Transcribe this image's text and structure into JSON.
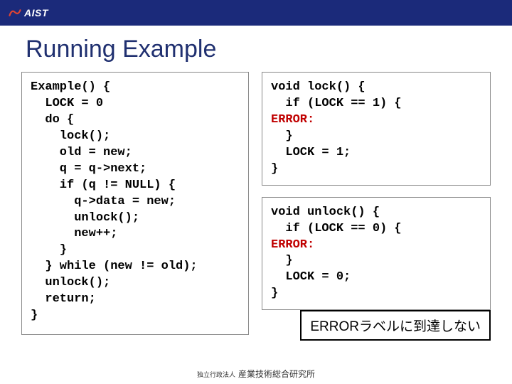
{
  "header": {
    "logo_text": "AIST"
  },
  "title": "Running Example",
  "code_left": {
    "lines": [
      "Example() {",
      "  LOCK = 0",
      "  do {",
      "    lock();",
      "    old = new;",
      "    q = q->next;",
      "    if (q != NULL) {",
      "      q->data = new;",
      "      unlock();",
      "      new++;",
      "    }",
      "  } while (new != old);",
      "  unlock();",
      "  return;",
      "}"
    ]
  },
  "code_right_top": {
    "lines": [
      "void lock() {",
      "  if (LOCK == 1) {",
      {
        "text": "ERROR:",
        "class": "error-label"
      },
      "  }",
      "  LOCK = 1;",
      "}"
    ]
  },
  "code_right_bottom": {
    "lines": [
      "void unlock() {",
      "  if (LOCK == 0) {",
      {
        "text": "ERROR:",
        "class": "error-label"
      },
      "  }",
      "  LOCK = 0;",
      "}"
    ]
  },
  "callout": "ERRORラベルに到達しない",
  "footer": {
    "small": "独立行政法人",
    "main": "産業技術総合研究所"
  }
}
